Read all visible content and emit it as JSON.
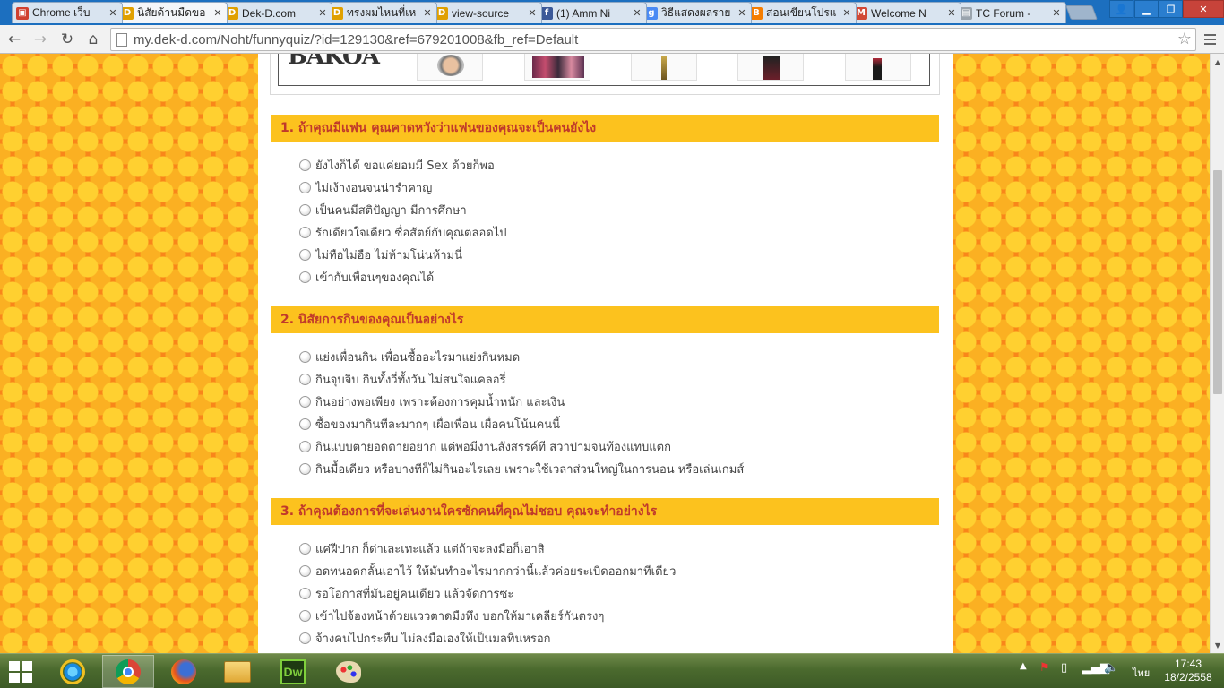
{
  "browser": {
    "tabs": [
      {
        "title": "Chrome เว็บ",
        "fav_color": "#d0402f",
        "fav_glyph": "▣",
        "active": false
      },
      {
        "title": "นิสัยด้านมืดขอ",
        "fav_color": "#e0a000",
        "fav_glyph": "D",
        "active": true
      },
      {
        "title": "Dek-D.com",
        "fav_color": "#e0a000",
        "fav_glyph": "D",
        "active": false
      },
      {
        "title": "ทรงผมไหนที่เห",
        "fav_color": "#e0a000",
        "fav_glyph": "D",
        "active": false
      },
      {
        "title": "view-source",
        "fav_color": "#e0a000",
        "fav_glyph": "D",
        "active": false
      },
      {
        "title": "(1) Amm Ni",
        "fav_color": "#3b5998",
        "fav_glyph": "f",
        "active": false
      },
      {
        "title": "วิธีแสดงผลราย",
        "fav_color": "#4a8af4",
        "fav_glyph": "g",
        "active": false
      },
      {
        "title": "สอนเขียนโปรแ",
        "fav_color": "#f57d00",
        "fav_glyph": "B",
        "active": false
      },
      {
        "title": "Welcome N",
        "fav_color": "#d14836",
        "fav_glyph": "M",
        "active": false
      },
      {
        "title": "TC Forum -",
        "fav_color": "#9aa4ad",
        "fav_glyph": "▤",
        "active": false
      }
    ],
    "url": "my.dek-d.com/Noht/funnyquiz/?id=129130&ref=679201008&fb_ref=Default"
  },
  "banner": {
    "logo": "BAKOA"
  },
  "questions": [
    {
      "title": "1. ถ้าคุณมีแฟน คุณคาดหวังว่าแฟนของคุณจะเป็นคนยังไง",
      "options": [
        "ยังไงก็ได้ ขอแค่ยอมมี Sex ด้วยก็พอ",
        "ไม่เง้างอนจนน่ารำคาญ",
        "เป็นคนมีสติปัญญา มีการศึกษา",
        "รักเดียวใจเดียว ซื่อสัตย์กับคุณตลอดไป",
        "ไม่ทือไม่อือ ไม่ห้ามโน่นห้ามนี่",
        "เข้ากับเพื่อนๆของคุณได้"
      ]
    },
    {
      "title": "2. นิสัยการกินของคุณเป็นอย่างไร",
      "options": [
        "แย่งเพื่อนกิน เพื่อนซื้ออะไรมาแย่งกินหมด",
        "กินจุบจิบ กินทั้งวี่ทั้งวัน ไม่สนใจแคลอรี่",
        "กินอย่างพอเพียง เพราะต้องการคุมน้ำหนัก และเงิน",
        "ซื้อของมากินทีละมากๆ เผื่อเพื่อน เผื่อคนโน้นคนนี้",
        "กินแบบตายอดตายอยาก แต่พอมีงานสังสรรค์ที สวาปามจนท้องแทบแตก",
        "กินมื้อเดียว หรือบางทีก็ไม่กินอะไรเลย เพราะใช้เวลาส่วนใหญ่ในการนอน หรือเล่นเกมส์"
      ]
    },
    {
      "title": "3. ถ้าคุณต้องการที่จะเล่นงานใครซักคนที่คุณไม่ชอบ คุณจะทำอย่างไร",
      "options": [
        "แค่ฝีปาก ก็ด่าเละเทะแล้ว แต่ถ้าจะลงมือก็เอาสิ",
        "อดทนอดกลั้นเอาไว้ ให้มันทำอะไรมากกว่านี้แล้วค่อยระเบิดออกมาทีเดียว",
        "รอโอกาสที่มันอยู่คนเดียว แล้วจัดการซะ",
        "เข้าไปจ้องหน้าด้วยแววตาดมืงทึง บอกให้มาเคลียร์กันตรงๆ",
        "จ้างคนไปกระทืบ ไม่ลงมือเองให้เป็นมลทินหรอก"
      ]
    }
  ],
  "taskbar": {
    "lang": "ไทย",
    "time": "17:43",
    "date": "18/2/2558",
    "apps": [
      "internet-explorer",
      "chrome",
      "firefox",
      "file-explorer",
      "dreamweaver",
      "paint"
    ]
  }
}
